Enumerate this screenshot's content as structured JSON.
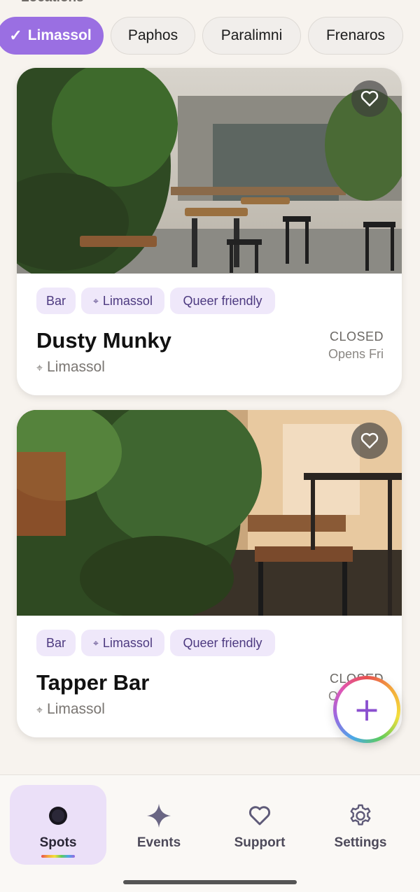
{
  "header": {
    "section_label": "Locations"
  },
  "locations": [
    {
      "label": "Limassol",
      "selected": true
    },
    {
      "label": "Paphos",
      "selected": false
    },
    {
      "label": "Paralimni",
      "selected": false
    },
    {
      "label": "Frenaros",
      "selected": false
    }
  ],
  "spots": [
    {
      "name": "Dusty Munky",
      "tags": [
        "Bar",
        "Limassol",
        "Queer friendly"
      ],
      "location": "Limassol",
      "status": "CLOSED",
      "opens": "Opens Fri",
      "favorite_icon": "heart-outline-icon"
    },
    {
      "name": "Tapper Bar",
      "tags": [
        "Bar",
        "Limassol",
        "Queer friendly"
      ],
      "location": "Limassol",
      "status": "CLOSED",
      "opens": "Opens Fri",
      "favorite_icon": "heart-outline-icon"
    }
  ],
  "fab": {
    "label": "+",
    "icon": "plus-icon"
  },
  "nav": [
    {
      "label": "Spots",
      "icon": "spots-icon",
      "active": true
    },
    {
      "label": "Events",
      "icon": "sparkle-icon",
      "active": false
    },
    {
      "label": "Support",
      "icon": "heart-icon",
      "active": false
    },
    {
      "label": "Settings",
      "icon": "gear-icon",
      "active": false
    }
  ],
  "colors": {
    "accent": "#9a6fe2",
    "tag_bg": "#efe8fa",
    "tag_text": "#4d3a80",
    "background": "#f7f3ee"
  }
}
